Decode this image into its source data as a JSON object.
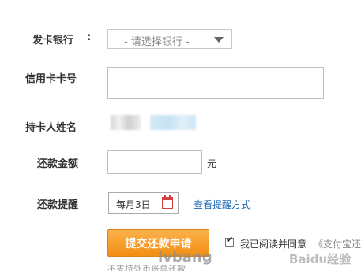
{
  "form": {
    "bank": {
      "label": "发卡银行",
      "colon": ":",
      "selected": "- 请选择银行 -"
    },
    "card_number": {
      "label": "信用卡卡号",
      "value": ""
    },
    "holder_name": {
      "label": "持卡人姓名"
    },
    "amount": {
      "label": "还款金额",
      "value": "",
      "unit": "元"
    },
    "reminder": {
      "label": "还款提醒",
      "date_value": "每月3日",
      "link": "查看提醒方式"
    },
    "submit_label": "提交还款申请",
    "agree": {
      "checked": true,
      "text": "我已阅读并同意",
      "link": "《支付宝还款"
    },
    "note": "不支持外币账单还款"
  },
  "watermarks": {
    "left": "lvbang",
    "right": "Baidu经验"
  },
  "colors": {
    "button": "#f5941e",
    "link": "#1a66b3",
    "calendar_icon": "#d24040"
  }
}
